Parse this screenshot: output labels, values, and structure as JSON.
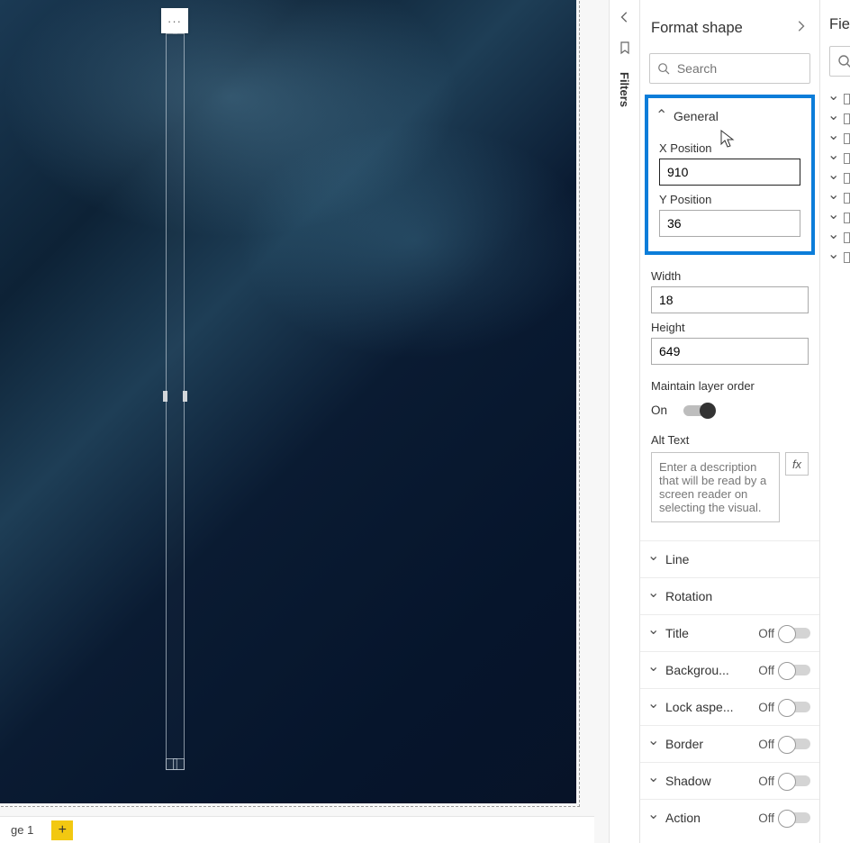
{
  "canvas": {
    "more_glyph": "···"
  },
  "tabs": {
    "page_label": "ge 1",
    "add_glyph": "+"
  },
  "filters": {
    "label": "Filters"
  },
  "format": {
    "title": "Format shape",
    "search_placeholder": "Search",
    "general": {
      "label": "General",
      "x_label": "X Position",
      "x_value": "910",
      "y_label": "Y Position",
      "y_value": "36",
      "w_label": "Width",
      "w_value": "18",
      "h_label": "Height",
      "h_value": "649",
      "maintain_label": "Maintain layer order",
      "maintain_state": "On",
      "alt_label": "Alt Text",
      "alt_placeholder": "Enter a description that will be read by a screen reader on selecting the visual.",
      "fx": "fx"
    },
    "sections": {
      "line": "Line",
      "rotation": "Rotation",
      "title": "Title",
      "background": "Backgrou...",
      "lock": "Lock aspe...",
      "border": "Border",
      "shadow": "Shadow",
      "action": "Action"
    },
    "off": "Off"
  },
  "fields": {
    "title": "Fie"
  }
}
